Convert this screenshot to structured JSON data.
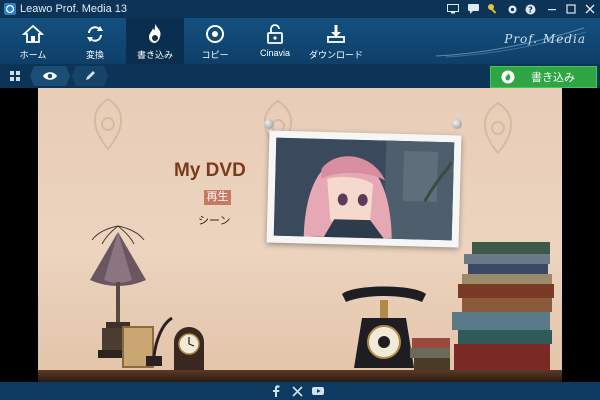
{
  "window": {
    "title": "Leawo Prof. Media 13"
  },
  "toolbar": {
    "items": [
      {
        "label": "ホーム",
        "icon": "home-icon"
      },
      {
        "label": "変換",
        "icon": "convert-icon"
      },
      {
        "label": "書き込み",
        "icon": "burn-icon"
      },
      {
        "label": "コピー",
        "icon": "copy-icon"
      },
      {
        "label": "Cinavia",
        "icon": "cinavia-lock-icon"
      },
      {
        "label": "ダウンロード",
        "icon": "download-icon"
      }
    ],
    "active_index": 2,
    "brand": "Prof. Media"
  },
  "subbar": {
    "tabs": [
      {
        "icon": "grid-icon"
      },
      {
        "icon": "eye-icon"
      },
      {
        "icon": "pencil-icon"
      }
    ],
    "burn_button": "書き込み"
  },
  "preview": {
    "menu_title": "My DVD",
    "play_label": "再生",
    "scene_label": "シーン"
  },
  "footer": {
    "icons": [
      "facebook-icon",
      "x-icon",
      "youtube-icon"
    ]
  },
  "colors": {
    "toolbar_bg": "#13507f",
    "active_tool_bg": "#0a2e4d",
    "burn_button_bg": "#2fa644",
    "menu_title_color": "#7a3a1c",
    "play_highlight": "#c87a60"
  }
}
